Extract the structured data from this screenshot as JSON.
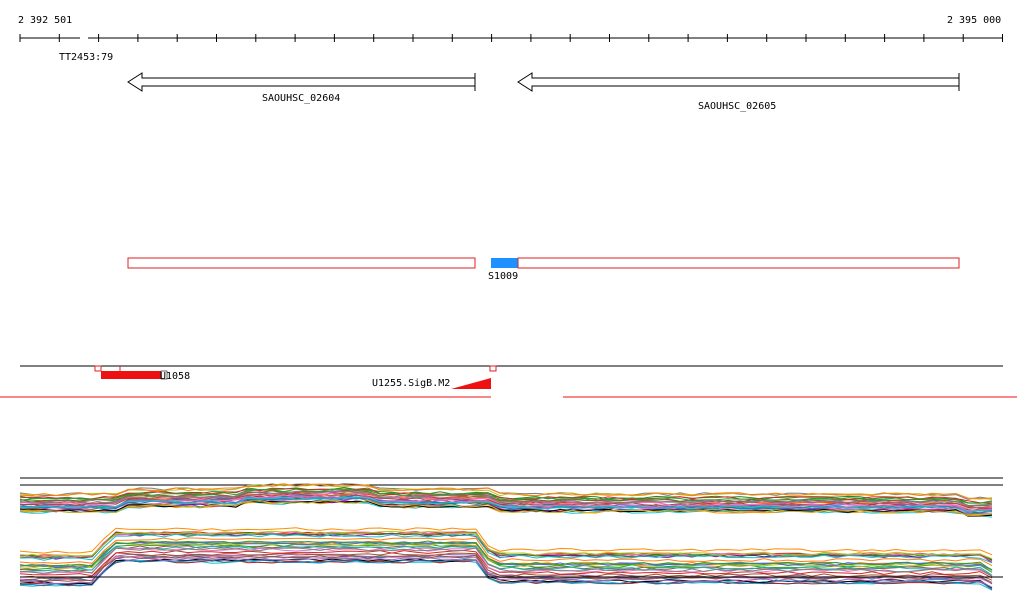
{
  "ruler": {
    "start_label": "2 392 501",
    "end_label": "2 395 000"
  },
  "features": {
    "transcript_label": "TT2453:79",
    "gene_1": "SAOUHSC_02604",
    "gene_2": "SAOUHSC_02605",
    "segment_label": "S1009",
    "upstream_label_a": "U1058",
    "upstream_label_b": "U1255.SigB.M2"
  },
  "colors": {
    "gene_arrow": "#000000",
    "segment_outline": "#dd2222",
    "segment_fill": "#1e90ff",
    "feature_red": "#ee1111",
    "baseline": "#000000"
  },
  "expression_traces": {
    "panel_1_series_count": 30,
    "panel_2_series_count": 30,
    "palette": [
      "#d62728",
      "#2ca02c",
      "#1f77b4",
      "#ff7f0e",
      "#9467bd",
      "#8c564b",
      "#e377c2",
      "#7f7f7f",
      "#bcbd22",
      "#17becf",
      "#b22222",
      "#228b22",
      "#4169e1",
      "#ff8c00",
      "#8b008b",
      "#a0522d",
      "#ff69b4",
      "#556b2f",
      "#20b2aa",
      "#000000"
    ]
  }
}
